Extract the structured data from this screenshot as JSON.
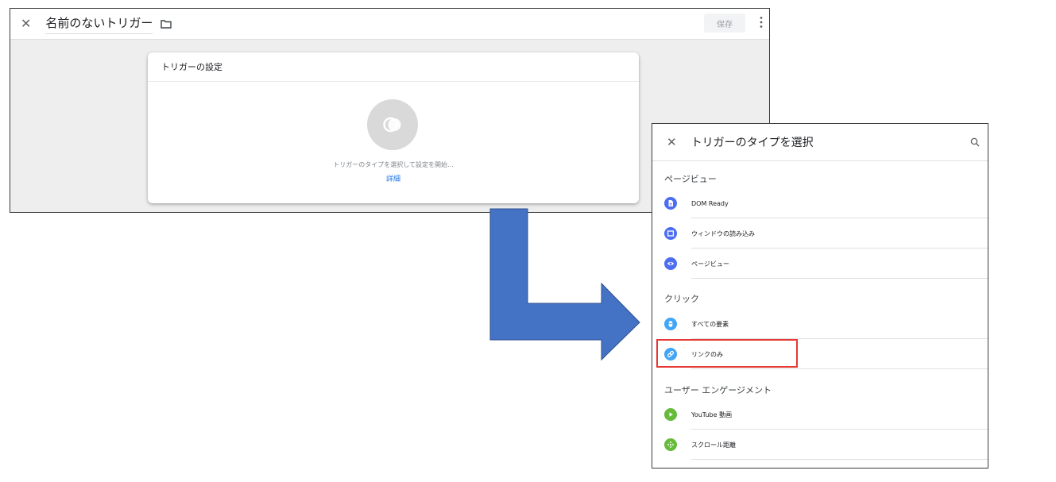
{
  "editor": {
    "title": "名前のないトリガー",
    "save_label": "保存",
    "card": {
      "title": "トリガーの設定",
      "hint": "トリガーのタイプを選択して設定を開始...",
      "details_link": "詳細"
    }
  },
  "chooser": {
    "title": "トリガーのタイプを選択",
    "sections": [
      {
        "label": "ページビュー",
        "items": [
          {
            "label": "DOM Ready",
            "icon": "document-icon",
            "color": "#4e6ef2"
          },
          {
            "label": "ウィンドウの読み込み",
            "icon": "window-icon",
            "color": "#4e6ef2"
          },
          {
            "label": "ページビュー",
            "icon": "eye-icon",
            "color": "#4e6ef2"
          }
        ]
      },
      {
        "label": "クリック",
        "items": [
          {
            "label": "すべての要素",
            "icon": "mouse-icon",
            "color": "#42a5f5"
          },
          {
            "label": "リンクのみ",
            "icon": "link-icon",
            "color": "#42a5f5"
          }
        ]
      },
      {
        "label": "ユーザー エンゲージメント",
        "items": [
          {
            "label": "YouTube 動画",
            "icon": "play-icon",
            "color": "#66bb3a"
          },
          {
            "label": "スクロール距離",
            "icon": "move-icon",
            "color": "#66bb3a"
          }
        ]
      }
    ]
  },
  "colors": {
    "arrow": "#4472c4",
    "highlight": "#e53935",
    "link": "#1a73e8"
  }
}
